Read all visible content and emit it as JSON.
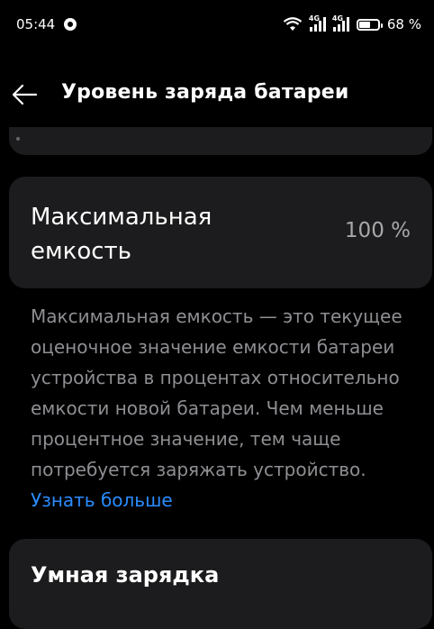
{
  "status_bar": {
    "time": "05:44",
    "network_type_1": "4G",
    "network_type_2": "4G",
    "battery_level": 68,
    "battery_text": "68 %"
  },
  "header": {
    "title": "Уровень заряда батареи"
  },
  "max_capacity": {
    "label": "Максимальная емкость",
    "value": "100 %"
  },
  "description": {
    "text": "Максимальная емкость — это текущее оценочное значение емкости батареи устройства в процентах относительно емкости новой батареи. Чем меньше процентное значение, тем чаще потребуется заряжать устройство.",
    "link": "Узнать больше",
    "link_color": "#2b8cff"
  },
  "smart_charging": {
    "label": "Умная зарядка"
  }
}
